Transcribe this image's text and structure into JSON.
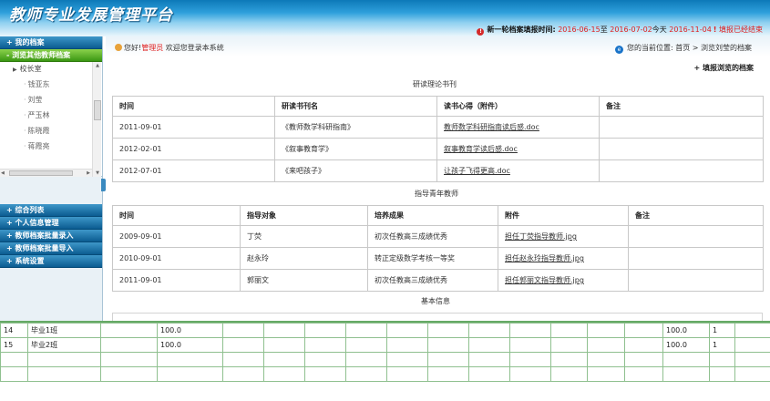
{
  "header": {
    "title": "教师专业发展管理平台",
    "notice": {
      "label": "新一轮档案填报时间:",
      "start": "2016-06-15",
      "to": "至",
      "end": "2016-07-02",
      "today_label": "今天",
      "today": "2016-11-04",
      "status": "填报已经结束"
    }
  },
  "sidebar": {
    "sections_top": [
      "我的档案",
      "浏览其他教师档案"
    ],
    "tree": {
      "org": "校长室",
      "people": [
        "钱亚东",
        "刘莹",
        "严玉林",
        "陈晓霞",
        "蒋霞亮"
      ]
    },
    "sections_bottom": [
      "综合列表",
      "个人信息管理",
      "教师档案批量录入",
      "教师档案批量导入",
      "系统设置"
    ]
  },
  "topbar": {
    "hello": "您好!",
    "user": "管理员",
    "welcome": "欢迎您登录本系统",
    "location_label": "您的当前位置:",
    "breadcrumb": "首页 > 浏览刘莹的档案"
  },
  "add_link": "+ 填报浏览的档案",
  "reading": {
    "caption": "研读理论书刊",
    "headers": [
      "时间",
      "研读书刊名",
      "读书心得（附件）",
      "备注"
    ],
    "rows": [
      [
        "2011-09-01",
        "《教师数学科研指南》",
        "教师数学科研指南读后感.doc",
        ""
      ],
      [
        "2012-02-01",
        "《叙事教育学》",
        "叙事教育学读后感.doc",
        ""
      ],
      [
        "2012-07-01",
        "《来吧孩子》",
        "让孩子飞得更高.doc",
        ""
      ]
    ]
  },
  "mentoring": {
    "caption": "指导青年教师",
    "headers": [
      "时间",
      "指导对象",
      "培养成果",
      "附件",
      "备注"
    ],
    "rows": [
      [
        "2009-09-01",
        "丁荧",
        "初次任教高三成绩优秀",
        "担任丁荧指导教师.jpg",
        ""
      ],
      [
        "2010-09-01",
        "赵永玲",
        "转正定级数学考核一等奖",
        "担任赵永玲指导教师.jpg",
        ""
      ],
      [
        "2011-09-01",
        "郭丽文",
        "初次任教高三成绩优秀",
        "担任郭丽文指导教师.jpg",
        ""
      ]
    ]
  },
  "basic_caption": "基本信息",
  "bottom_table": {
    "rows": [
      [
        "14",
        "毕业1班",
        "",
        "100.0",
        "",
        "",
        "",
        "",
        "",
        "",
        "",
        "",
        "",
        "",
        "",
        "100.0",
        "1",
        ""
      ],
      [
        "15",
        "毕业2班",
        "",
        "100.0",
        "",
        "",
        "",
        "",
        "",
        "",
        "",
        "",
        "",
        "",
        "",
        "100.0",
        "1",
        ""
      ]
    ]
  }
}
